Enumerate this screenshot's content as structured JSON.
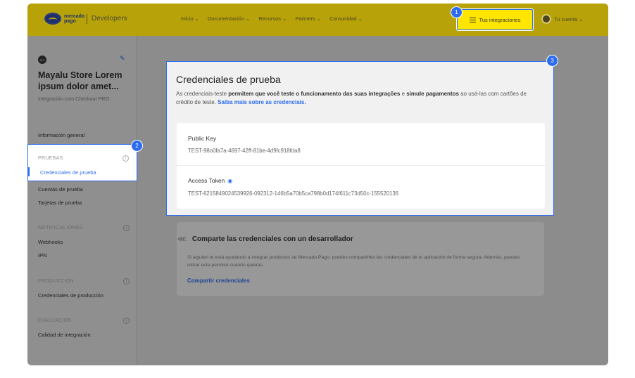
{
  "header": {
    "logo_text": "mercado pago",
    "logo_suffix": "Developers",
    "nav": [
      "Inicio ⌄",
      "Documentación ⌄",
      "Recursos ⌄",
      "Partners ⌄",
      "Comunidad ⌄"
    ],
    "integrations_button": "Tus integraciones",
    "account": "Tu cuenta ⌄"
  },
  "sidebar": {
    "avatar_initials": "MS",
    "app_name": "Mayalu Store Lorem ipsum dolor amet...",
    "app_subtitle": "Integración com Checkout PRO",
    "general": "Información general",
    "sections": [
      {
        "title": "PRUEBAS",
        "items": [
          "Credenciales de prueba",
          "Cuentas de prueba",
          "Tarjetas de prueba"
        ]
      },
      {
        "title": "NOTIFICACIONES",
        "items": [
          "Webhooks",
          "IPN"
        ]
      },
      {
        "title": "PRODUCCIÓN",
        "items": [
          "Credenciales de producción"
        ]
      },
      {
        "title": "EVALUACIÓN",
        "items": [
          "Calidad de integración"
        ]
      }
    ]
  },
  "credentials": {
    "title": "Credenciales de prueba",
    "desc_1": "As credenciais-teste ",
    "desc_2": "permitem que você teste o funcionamento das suas integrações",
    "desc_3": " e ",
    "desc_4": "simule pagamentos",
    "desc_5": " ao usá-las com cartões de crédito de teste. ",
    "desc_link": "Saiba mais sobre as credenciais.",
    "public_key_label": "Public Key",
    "public_key_value": "TEST-98o0fa7a-4697-42ff-81be-4d9fc918fda8",
    "access_token_label": "Access Token",
    "access_token_value": "TEST-6215849024539926-092312-146b5a70b5ca798b0d174f611c73d50c-155520136"
  },
  "share": {
    "title": "Comparte las credenciales con un desarrollador",
    "text": "Si alguien te está ayudando a integrar productos de Mercado Pago, puedes compartirles las credenciales de tu aplicación de forma segura. Además, puedes retirar este permiso cuando quieras.",
    "link": "Compartir credenciales"
  },
  "badges": [
    "1",
    "2",
    "3"
  ],
  "colors": {
    "brand_yellow": "#ffe600",
    "accent_blue": "#2c6cf1"
  }
}
